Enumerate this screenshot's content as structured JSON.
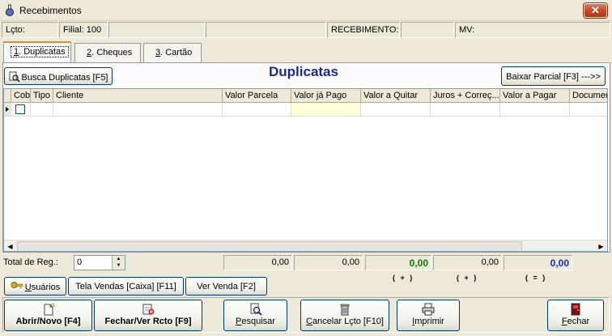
{
  "window": {
    "title": "Recebimentos",
    "close_label": "✕"
  },
  "info": {
    "lcto_label": "Lçto:",
    "filial_label": "Filial: 100",
    "recebimento_label": "RECEBIMENTO:",
    "mv_label": "MV:"
  },
  "tabs": [
    {
      "key": "1",
      "label": ". Duplicatas"
    },
    {
      "key": "2",
      "label": ". Cheques"
    },
    {
      "key": "3",
      "label": ". Cartão"
    }
  ],
  "section_title": "Duplicatas",
  "buttons": {
    "busca": "Busca Duplicatas [F5]",
    "baixar": "Baixar Parcial [F3] --->>"
  },
  "grid": {
    "columns": [
      "Cob",
      "Tipo",
      "Cliente",
      "Valor Parcela",
      "Valor já Pago",
      "Valor a Quitar",
      "Juros + Correç...",
      "Valor a Pagar",
      "Documen"
    ]
  },
  "totals": {
    "label": "Total de Reg.:",
    "count": "0",
    "valor_parcela": "0,00",
    "valor_pago": "0,00",
    "valor_quitar": "0,00",
    "juros": "0,00",
    "valor_pagar": "0,00",
    "plus1": "( + )",
    "plus2": "( + )",
    "equals": "( = )",
    "quitar_color": "#0a7a0a",
    "pagar_color": "#1a2bc8"
  },
  "small_buttons": {
    "usuarios": "suários",
    "usuarios_key": "U",
    "tela_vendas": "Tela Vendas [Caixa] [F11]",
    "ver_venda": "Ver Venda [F2]"
  },
  "actions": {
    "abrir": "Abrir/Novo [F4]",
    "fechar_rcto": "Fechar/Ver Rcto [F9]",
    "pesquisar_key": "P",
    "pesquisar": "esquisar",
    "cancelar_key": "C",
    "cancelar": "ancelar Lçto [F10]",
    "imprimir_key": "I",
    "imprimir": "mprimir",
    "fechar_key": "F",
    "fechar": "echar"
  }
}
